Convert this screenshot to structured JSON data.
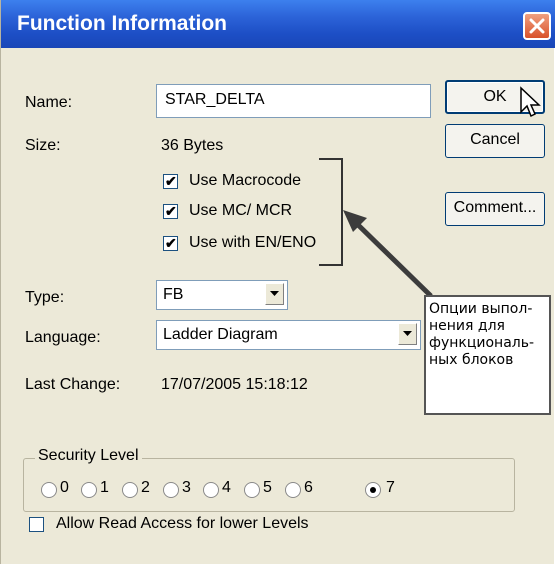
{
  "window": {
    "title": "Function Information",
    "close_icon": "close-icon"
  },
  "fields": {
    "name_label": "Name:",
    "name_value": "STAR_DELTA",
    "size_label": "Size:",
    "size_value": "36 Bytes",
    "type_label": "Type:",
    "type_value": "FB",
    "language_label": "Language:",
    "language_value": "Ladder Diagram",
    "last_change_label": "Last Change:",
    "last_change_value": "17/07/2005 15:18:12"
  },
  "options": [
    {
      "label": "Use Macrocode",
      "checked": true
    },
    {
      "label": "Use MC/ MCR",
      "checked": true
    },
    {
      "label": "Use with EN/ENO",
      "checked": true
    }
  ],
  "buttons": {
    "ok": "OK",
    "cancel": "Cancel",
    "comment": "Comment..."
  },
  "security": {
    "title": "Security Level",
    "levels": [
      "0",
      "1",
      "2",
      "3",
      "4",
      "5",
      "6",
      "7"
    ],
    "selected": "7"
  },
  "allow_read": {
    "label": "Allow Read Access for lower Levels",
    "checked": false
  },
  "annotation": {
    "lines": [
      "Опции выпол-",
      "нения для",
      "функциональ-",
      "ных блоков"
    ]
  },
  "colors": {
    "title_bar": "#2c63d8",
    "dialog_bg": "#ece9d8",
    "close_button": "#d9522b"
  }
}
